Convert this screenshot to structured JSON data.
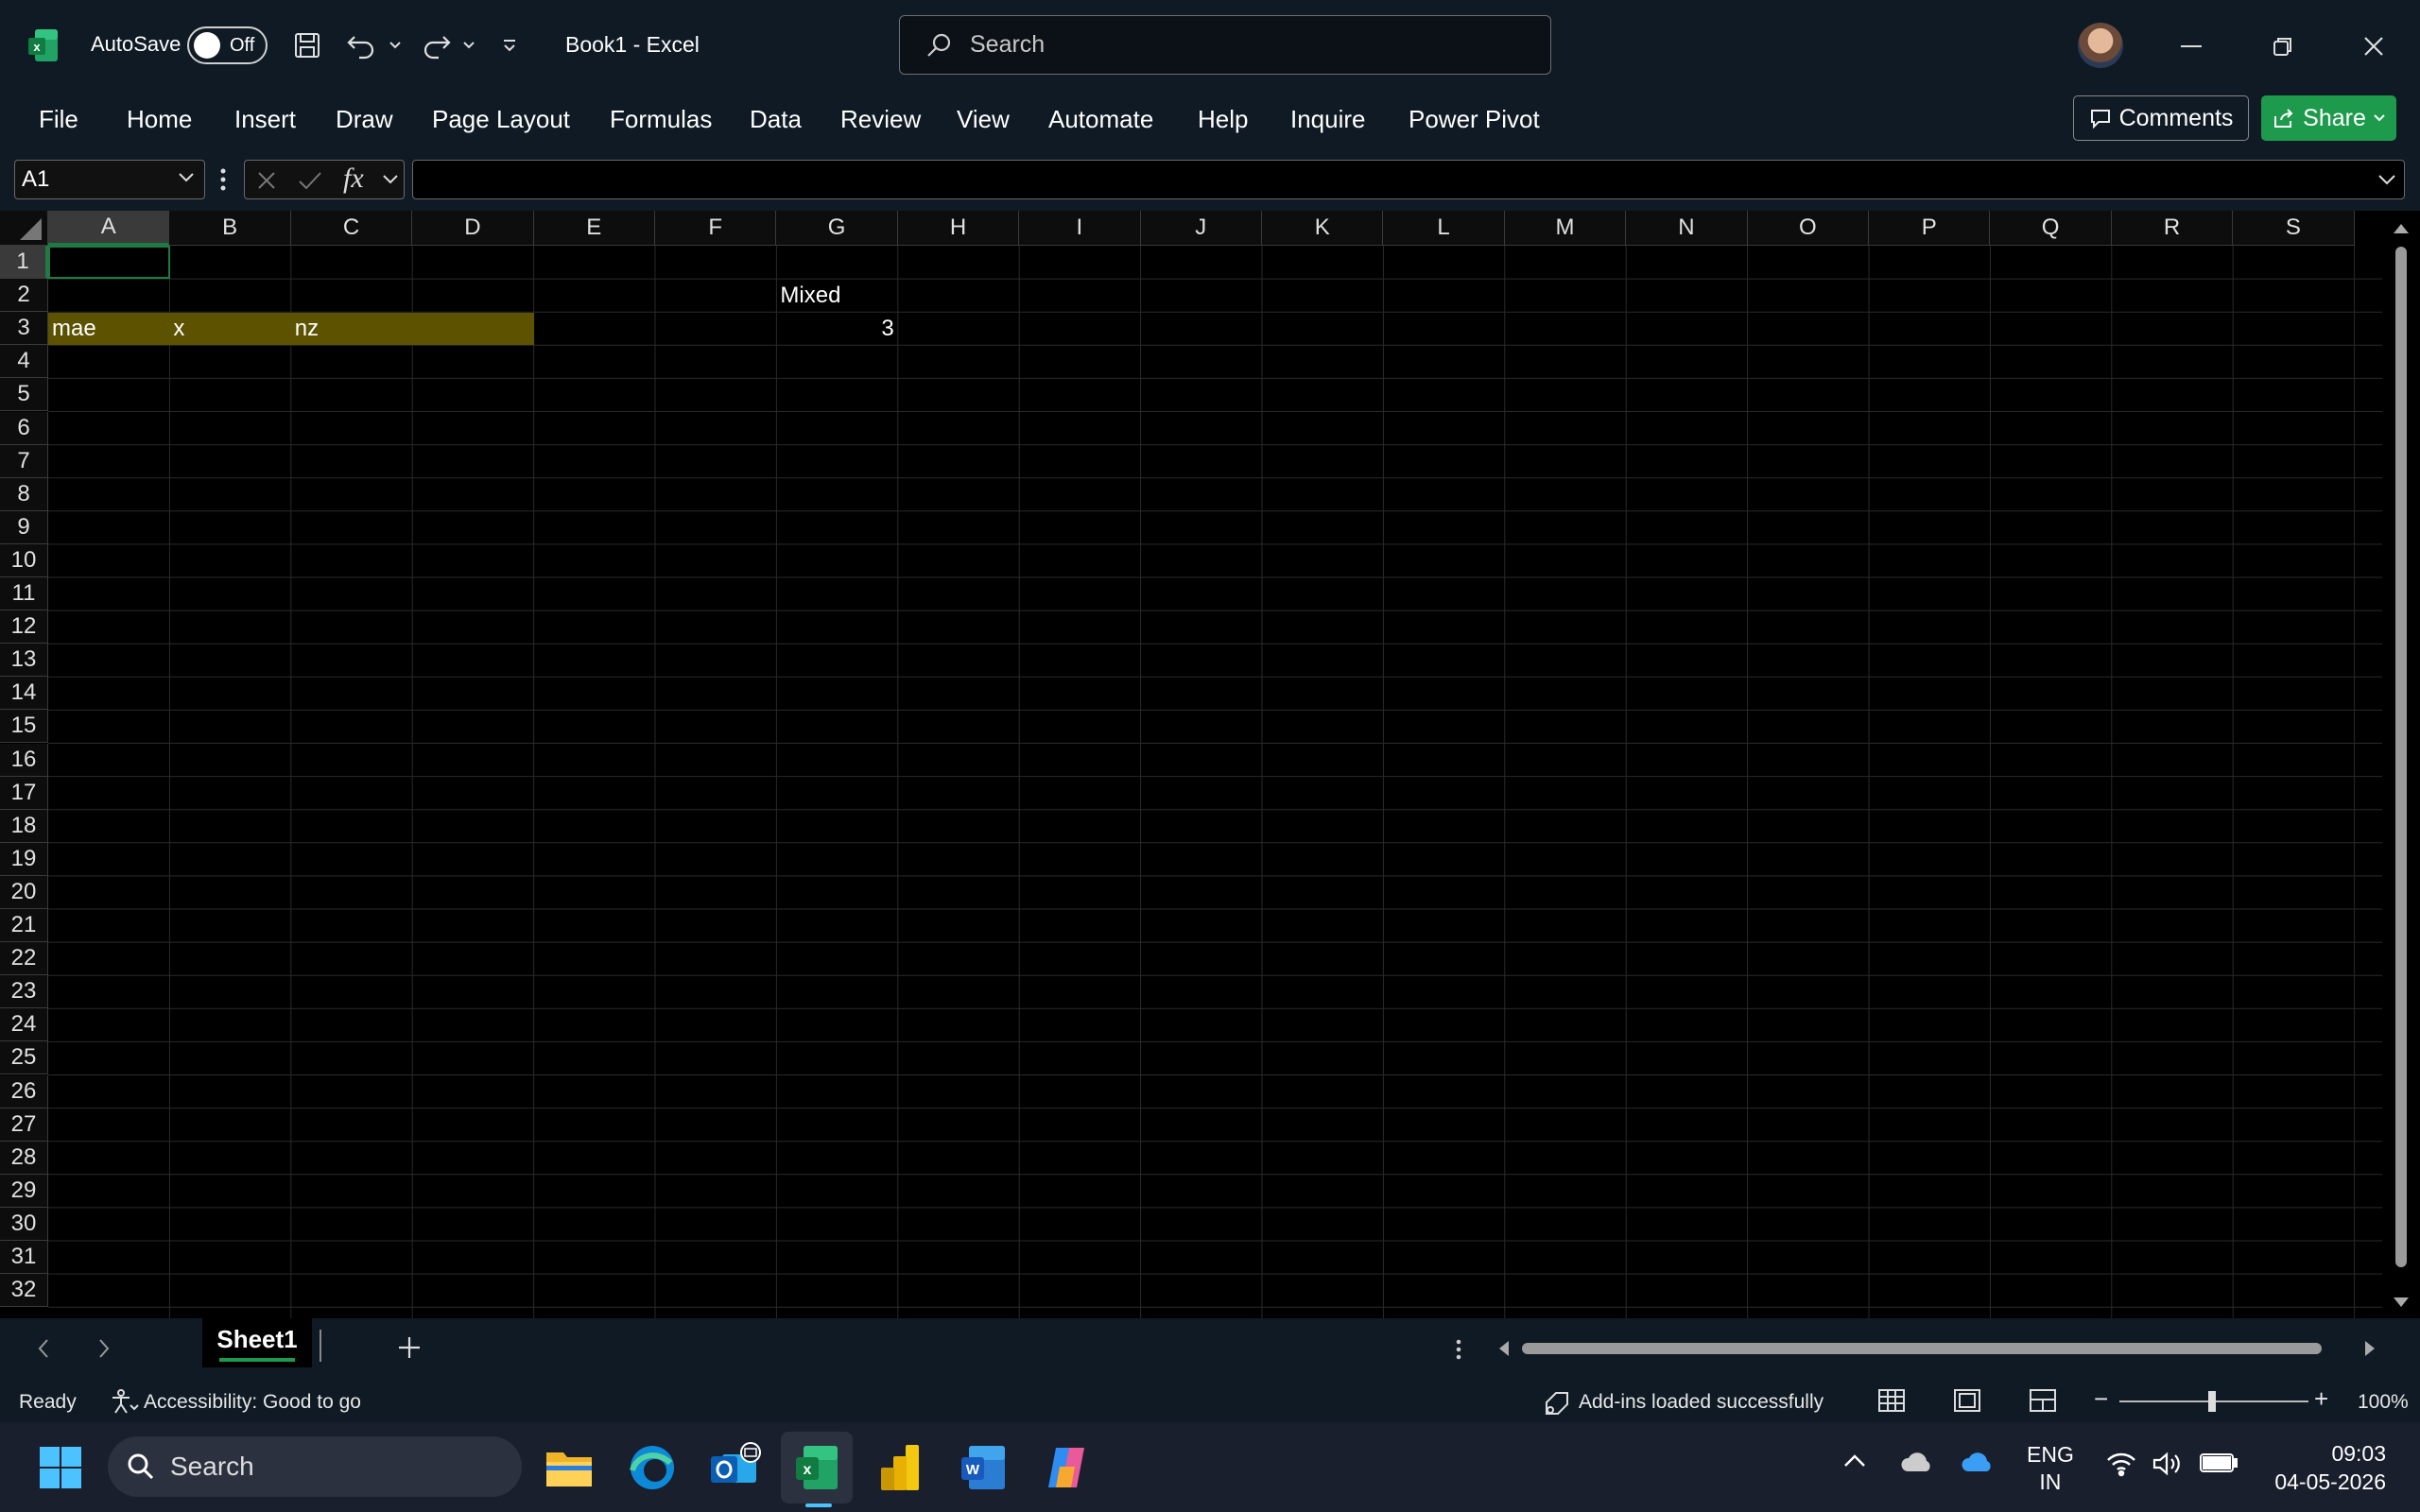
{
  "titlebar": {
    "autosave_label": "AutoSave",
    "autosave_state": "Off",
    "doc_title": "Book1  -  Excel",
    "search_placeholder": "Search"
  },
  "menu": [
    "File",
    "Home",
    "Insert",
    "Draw",
    "Page Layout",
    "Formulas",
    "Data",
    "Review",
    "View",
    "Automate",
    "Help",
    "Inquire",
    "Power Pivot"
  ],
  "actions": {
    "comments": "Comments",
    "share": "Share"
  },
  "formula_bar": {
    "name_box": "A1",
    "fx": "fx",
    "formula": ""
  },
  "grid": {
    "columns": [
      "A",
      "B",
      "C",
      "D",
      "E",
      "F",
      "G",
      "H",
      "I",
      "J",
      "K",
      "L",
      "M",
      "N",
      "O",
      "P",
      "Q",
      "R",
      "S"
    ],
    "rows": [
      "1",
      "2",
      "3",
      "4",
      "5",
      "6",
      "7",
      "8",
      "9",
      "10",
      "11",
      "12",
      "13",
      "14",
      "15",
      "16",
      "17",
      "18",
      "19",
      "20",
      "21",
      "22",
      "23",
      "24",
      "25",
      "26",
      "27",
      "28",
      "29",
      "30",
      "31",
      "32"
    ],
    "selected_cell": "A1",
    "cells": {
      "G2": "Mixed",
      "A3": "mae",
      "B3": "x",
      "C3": "nz",
      "G3": "3"
    },
    "highlight_fill": "#5c5200"
  },
  "sheets": {
    "active": "Sheet1"
  },
  "status": {
    "ready": "Ready",
    "accessibility": "Accessibility: Good to go",
    "addins": "Add-ins loaded successfully",
    "zoom": "100%"
  },
  "taskbar": {
    "search_placeholder": "Search",
    "lang_top": "ENG",
    "lang_bottom": "IN",
    "time": "09:03",
    "date": "04-05-2026"
  },
  "colors": {
    "accent": "#1d9a4c",
    "chrome": "#0f1a24",
    "grid_line": "#2a2a2a"
  }
}
